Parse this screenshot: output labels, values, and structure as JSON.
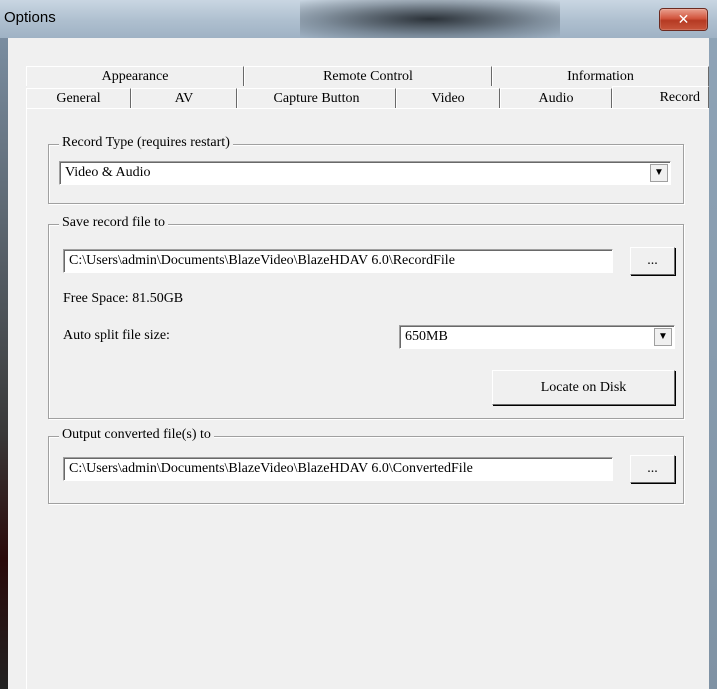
{
  "window": {
    "title": "Options",
    "close_icon": "close-icon"
  },
  "tabs_row1": [
    {
      "label": "Appearance"
    },
    {
      "label": "Remote Control"
    },
    {
      "label": "Information"
    }
  ],
  "tabs_row2": [
    {
      "label": "General"
    },
    {
      "label": "AV"
    },
    {
      "label": "Capture Button"
    },
    {
      "label": "Video"
    },
    {
      "label": "Audio"
    },
    {
      "label": "Record"
    }
  ],
  "record_type": {
    "legend": "Record Type (requires restart)",
    "value": "Video & Audio"
  },
  "save_record": {
    "legend": "Save record file to",
    "path": "C:\\Users\\admin\\Documents\\BlazeVideo\\BlazeHDAV 6.0\\RecordFile",
    "browse_label": "...",
    "free_space": "Free Space: 81.50GB",
    "split_label": "Auto split file size:",
    "split_value": "650MB",
    "locate_label": "Locate on Disk"
  },
  "output_converted": {
    "legend": "Output converted file(s) to",
    "path": "C:\\Users\\admin\\Documents\\BlazeVideo\\BlazeHDAV 6.0\\ConvertedFile",
    "browse_label": "..."
  }
}
